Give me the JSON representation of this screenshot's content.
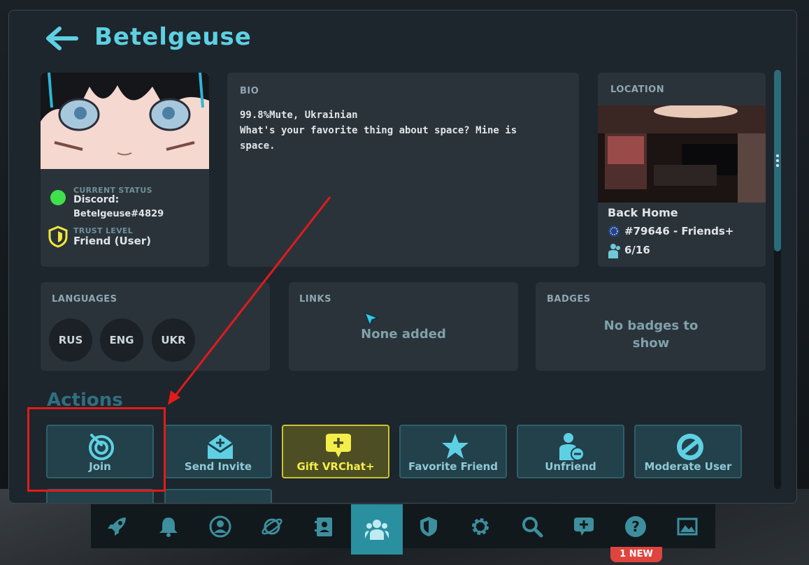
{
  "header": {
    "title": "Betelgeuse"
  },
  "profile": {
    "status_label": "CURRENT STATUS",
    "status_text": "Discord:",
    "status_text_2": "Betelgeuse#4829",
    "status_color": "#3fe04a",
    "trust_label": "TRUST LEVEL",
    "trust_value": "Friend (User)",
    "trust_color": "#f2e83a"
  },
  "bio": {
    "label": "BIO",
    "text": "99.8%Mute, Ukrainian\nWhat's your favorite thing about space? Mine is\nspace."
  },
  "location": {
    "label": "LOCATION",
    "world_name": "Back Home",
    "instance": "#79646 - Friends+",
    "occupancy": "6/16"
  },
  "languages": {
    "label": "LANGUAGES",
    "items": [
      "RUS",
      "ENG",
      "UKR"
    ]
  },
  "links": {
    "label": "LINKS",
    "empty_text": "None added"
  },
  "badges": {
    "label": "BADGES",
    "empty_text": "No badges to show"
  },
  "actions": {
    "title": "Actions",
    "buttons": [
      {
        "label": "Join",
        "icon": "join-icon"
      },
      {
        "label": "Send Invite",
        "icon": "invite-envelope-icon"
      },
      {
        "label": "Gift VRChat+",
        "icon": "gift-plus-icon"
      },
      {
        "label": "Favorite Friend",
        "icon": "star-icon"
      },
      {
        "label": "Unfriend",
        "icon": "user-minus-icon"
      },
      {
        "label": "Moderate User",
        "icon": "block-icon"
      }
    ]
  },
  "taskbar": {
    "items": [
      "rocket-icon",
      "bell-icon",
      "profile-icon",
      "planet-icon",
      "contacts-icon",
      "social-icon",
      "shield-icon",
      "gear-icon",
      "search-icon",
      "chat-plus-icon",
      "help-icon",
      "gallery-icon"
    ],
    "active_index": 5,
    "badge_text": "1 NEW"
  },
  "colors": {
    "accent": "#5fd0e3",
    "annotation": "#e11b1b",
    "gift": "#f4ee4a"
  }
}
